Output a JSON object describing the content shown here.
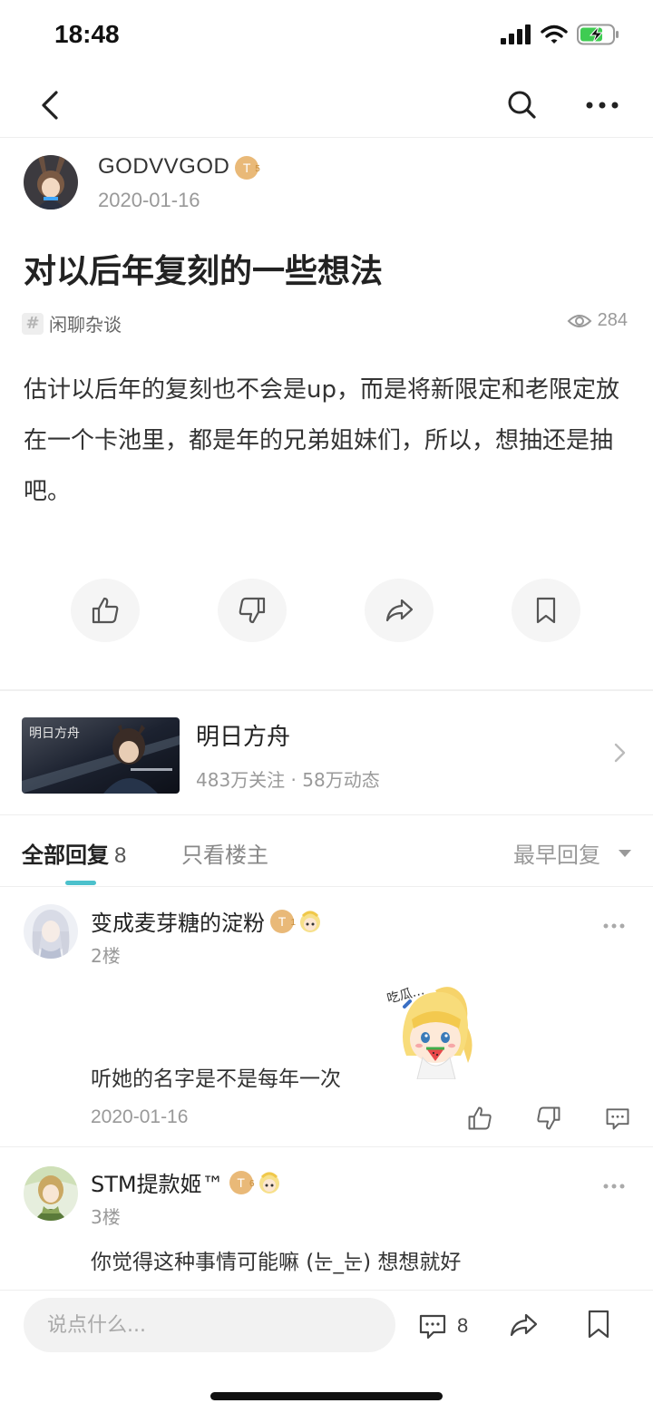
{
  "status_bar": {
    "time": "18:48"
  },
  "post": {
    "author": {
      "name": "GODVVGOD",
      "level": "T",
      "level_num": "5",
      "date": "2020-01-16"
    },
    "title": "对以后年复刻的一些想法",
    "tag": "闲聊杂谈",
    "views": "284",
    "body": "估计以后年的复刻也不会是up，而是将新限定和老限定放在一个卡池里，都是年的兄弟姐妹们，所以，想抽还是抽吧。"
  },
  "game": {
    "name": "明日方舟",
    "stats": "483万关注 · 58万动态",
    "cover_text": "明日方舟"
  },
  "tabs": {
    "all_label": "全部回复",
    "all_count": "8",
    "op_only": "只看楼主",
    "sort": "最早回复"
  },
  "replies": [
    {
      "user": "变成麦芽糖的淀粉",
      "level": "T",
      "level_num": "1",
      "floor": "2楼",
      "text": "听她的名字是不是每年一次",
      "sticker_text": "吃瓜…",
      "date": "2020-01-16"
    },
    {
      "user": "STM提款姬™",
      "level": "T",
      "level_num": "6",
      "floor": "3楼",
      "text": "你觉得这种事情可能嘛 (눈_눈) 想想就好"
    }
  ],
  "bottom_bar": {
    "input_placeholder": "说点什么...",
    "comment_count": "8"
  },
  "colors": {
    "accent": "#4cc1cc",
    "badge": "#e9b978"
  }
}
